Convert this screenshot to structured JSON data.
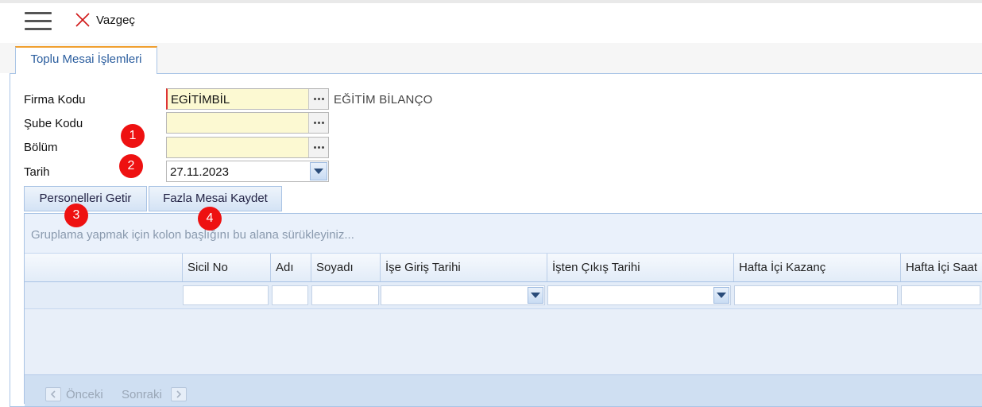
{
  "toolbar": {
    "menu_icon": "hamburger-menu-icon",
    "cancel_icon": "close-x-icon",
    "cancel_label": "Vazgeç"
  },
  "tab": {
    "label": "Toplu Mesai İşlemleri"
  },
  "form": {
    "firma_kodu_label": "Firma Kodu",
    "firma_kodu_value": "EGİTİMBİL",
    "firma_name": "EĞİTİM BİLANÇO",
    "sube_kodu_label": "Şube Kodu",
    "sube_kodu_value": "",
    "bolum_label": "Bölüm",
    "bolum_value": "",
    "tarih_label": "Tarih",
    "tarih_value": "27.11.2023"
  },
  "badges": [
    "1",
    "2",
    "3",
    "4"
  ],
  "buttons": {
    "getir": "Personelleri Getir",
    "kaydet": "Fazla Mesai Kaydet"
  },
  "grid": {
    "group_hint": "Gruplama yapmak için kolon başlığını bu alana sürükleyiniz...",
    "columns": [
      "Sicil No",
      "Adı",
      "Soyadı",
      "İşe Giriş Tarihi",
      "İşten Çıkış Tarihi",
      "Hafta İçi Kazanç",
      "Hafta İçi Saat"
    ]
  },
  "pager": {
    "prev": "Önceki",
    "next": "Sonraki"
  },
  "colors": {
    "accent_tab": "#f0a030",
    "badge": "#ee1111",
    "field_bg": "#fcf9d2"
  }
}
